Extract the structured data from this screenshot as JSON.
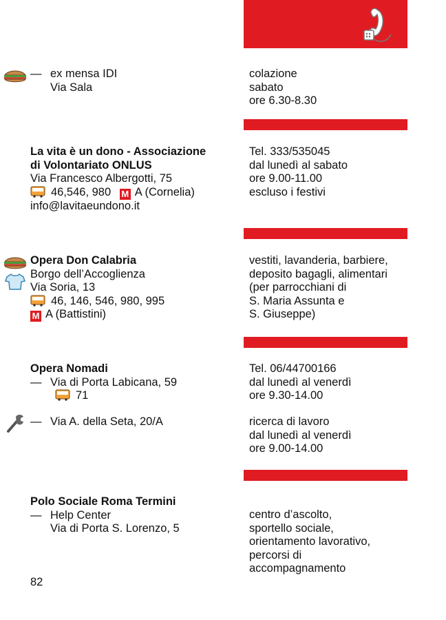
{
  "header": {
    "phone_icon": "phone-handset-icon"
  },
  "entries": [
    {
      "lines": {
        "l1": "ex mensa IDI",
        "l2": "Via Sala"
      },
      "right": {
        "r1": "colazione",
        "r2": "sabato",
        "r3": "ore 6.30-8.30"
      }
    },
    {
      "lines": {
        "title1": "La vita è un dono - Associazione",
        "title2": "di Volontariato ONLUS",
        "address": "Via Francesco Albergotti, 75",
        "bus": "46,546, 980",
        "metro_label": "M",
        "metro": "A (Cornelia)",
        "email": "info@lavitaeundono.it"
      },
      "right": {
        "r1": "Tel. 333/535045",
        "r2": "dal lunedì al sabato",
        "r3": "ore 9.00-11.00",
        "r4": "escluso i festivi"
      }
    },
    {
      "lines": {
        "title": "Opera Don Calabria",
        "sub": "Borgo dell’Accoglienza",
        "address": "Via Soria, 13",
        "bus": "46, 146, 546, 980, 995",
        "metro_label": "M",
        "metro": "A (Battistini)"
      },
      "right": {
        "r1": "vestiti, lavanderia, barbiere,",
        "r2": "deposito bagagli, alimentari",
        "r3": "(per parrocchiani di",
        "r4": "S. Maria Assunta e",
        "r5": "S. Giuseppe)"
      }
    },
    {
      "lines": {
        "title": "Opera Nomadi",
        "address": "Via di Porta Labicana, 59",
        "bus": "71",
        "address2": "Via A. della Seta, 20/A"
      },
      "right": {
        "r1": "Tel. 06/44700166",
        "r2": "dal lunedì al venerdì",
        "r3": "ore 9.30-14.00",
        "r4": "ricerca di lavoro",
        "r5": "dal lunedì al venerdì",
        "r6": "ore 9.00-14.00"
      }
    },
    {
      "lines": {
        "title": "Polo Sociale Roma Termini",
        "l1": "Help Center",
        "l2": "Via di Porta S. Lorenzo, 5"
      },
      "right": {
        "r1": "centro d’ascolto,",
        "r2": "sportello sociale,",
        "r3": "orientamento lavorativo,",
        "r4": "percorsi di",
        "r5": "accompagnamento"
      }
    }
  ],
  "dash": "—",
  "page_number": "82",
  "icons": [
    "sandwich-icon",
    "tshirt-icon",
    "wrench-icon",
    "bus-icon",
    "metro-icon"
  ]
}
